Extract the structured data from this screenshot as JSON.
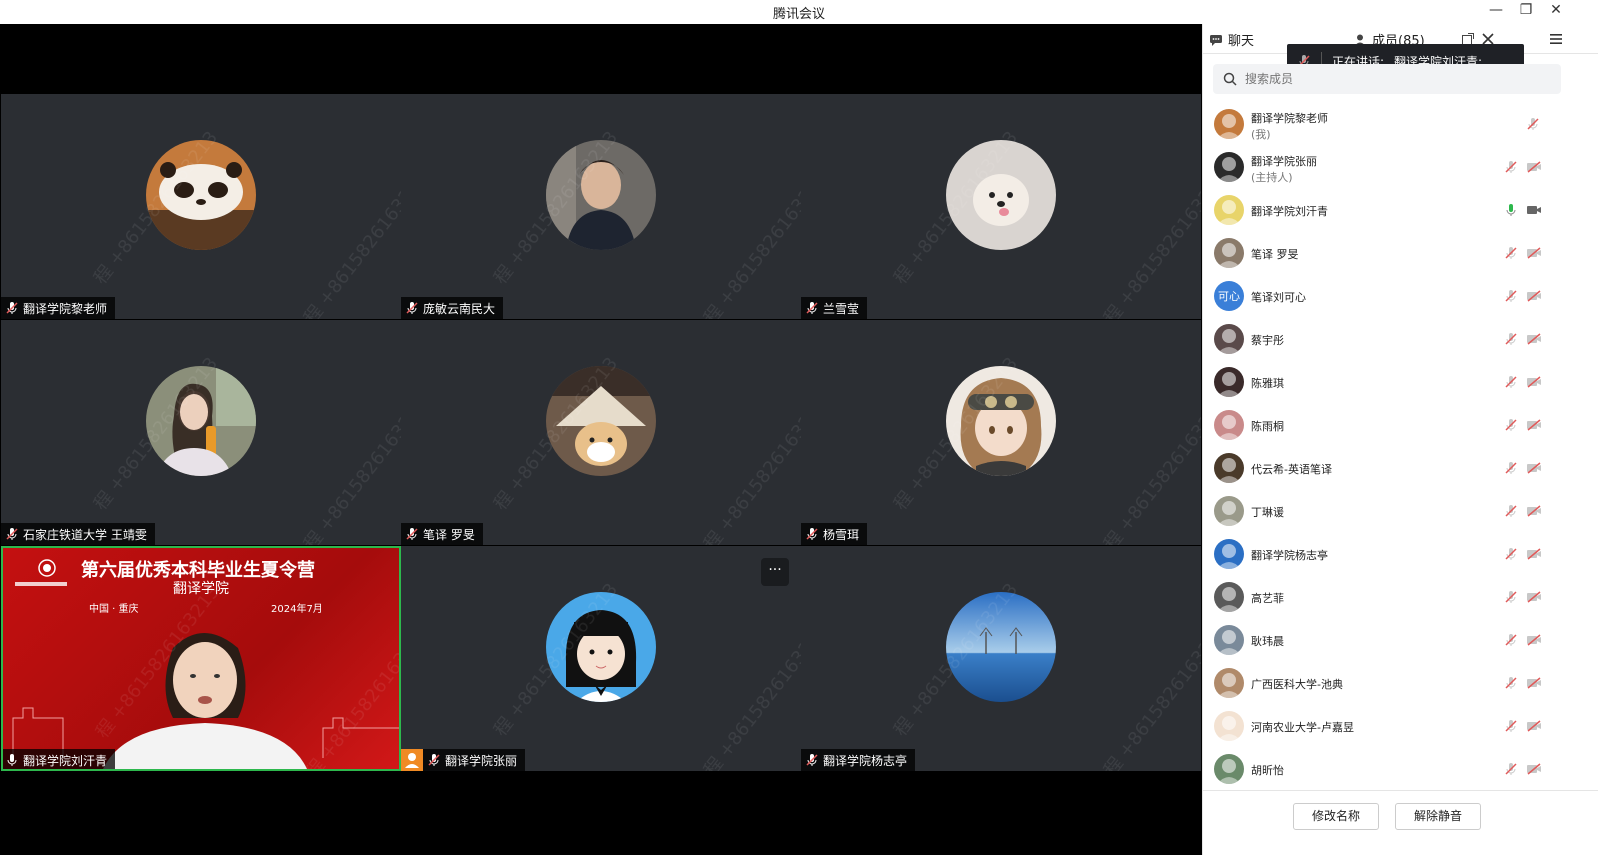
{
  "window": {
    "title": "腾讯会议",
    "minimize": "—",
    "restore": "❐",
    "close": "✕"
  },
  "watermark": "程 +8615826163213",
  "tiles": [
    {
      "name": "翻译学院黎老师"
    },
    {
      "name": "庞敏云南民大"
    },
    {
      "name": "兰雪莹"
    },
    {
      "name": "石家庄铁道大学 王靖雯"
    },
    {
      "name": "笔译 罗旻"
    },
    {
      "name": "杨雪珥"
    },
    {
      "name": "翻译学院刘汗青"
    },
    {
      "name": "翻译学院张丽"
    },
    {
      "name": "翻译学院杨志亭"
    }
  ],
  "banner": {
    "title": "第六届优秀本科毕业生夏令营",
    "subtitle": "翻译学院",
    "place": "中国 · 重庆",
    "date": "2024年7月"
  },
  "more_label": "···",
  "panel": {
    "tab_chat": "聊天",
    "tab_members": "成员(85)",
    "speaking_label": "正在讲话:",
    "speaking_name": "翻译学院刘汗青;",
    "search_placeholder": "搜索成员",
    "members": [
      {
        "name": "翻译学院黎老师",
        "sub": "(我)"
      },
      {
        "name": "翻译学院张丽",
        "sub": "(主持人)"
      },
      {
        "name": "翻译学院刘汗青",
        "sub": ""
      },
      {
        "name": "笔译 罗旻",
        "sub": ""
      },
      {
        "name": "笔译刘可心",
        "sub": "",
        "avatar_text": "可心"
      },
      {
        "name": "蔡宇彤",
        "sub": ""
      },
      {
        "name": "陈雅琪",
        "sub": ""
      },
      {
        "name": "陈雨桐",
        "sub": ""
      },
      {
        "name": "代云希-英语笔译",
        "sub": ""
      },
      {
        "name": "丁琳谖",
        "sub": ""
      },
      {
        "name": "翻译学院杨志亭",
        "sub": ""
      },
      {
        "name": "高艺菲",
        "sub": ""
      },
      {
        "name": "耿玮晨",
        "sub": ""
      },
      {
        "name": "广西医科大学-池典",
        "sub": ""
      },
      {
        "name": "河南农业大学-卢嘉昱",
        "sub": ""
      },
      {
        "name": "胡昕怡",
        "sub": ""
      }
    ],
    "btn_rename": "修改名称",
    "btn_unmute": "解除静音"
  },
  "colors": {
    "accent_green": "#2db84d",
    "tile_bg": "#2b2e33",
    "mute_red": "#e05a5a"
  }
}
